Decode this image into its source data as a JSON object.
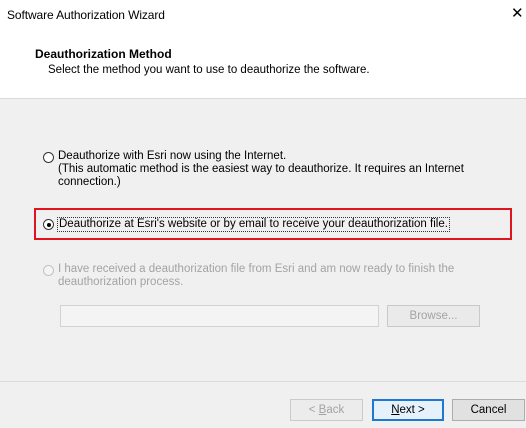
{
  "window": {
    "title": "Software Authorization Wizard",
    "close_glyph": "✕"
  },
  "header": {
    "title": "Deauthorization Method",
    "subtitle": "Select the method you want to use to deauthorize the software."
  },
  "options": [
    {
      "label": "Deauthorize with Esri now using the Internet.\n(This automatic method is the easiest way to deauthorize. It requires an Internet connection.)",
      "checked": false,
      "enabled": true
    },
    {
      "label": "Deauthorize at Esri's website or by email to receive your deauthorization file.",
      "checked": true,
      "enabled": true
    },
    {
      "label": "I have received a deauthorization file from Esri and am now ready to finish the deauthorization process.",
      "checked": false,
      "enabled": false
    }
  ],
  "file_input": {
    "value": ""
  },
  "buttons": {
    "browse": "Browse...",
    "back_underline": "B",
    "back_rest": "ack",
    "back_prefix": "< ",
    "next_underline": "N",
    "next_rest": "ext >",
    "cancel": "Cancel"
  },
  "colors": {
    "highlight": "#e0141e",
    "default_button_border": "#1b78d3",
    "panel": "#f0f0f0"
  }
}
